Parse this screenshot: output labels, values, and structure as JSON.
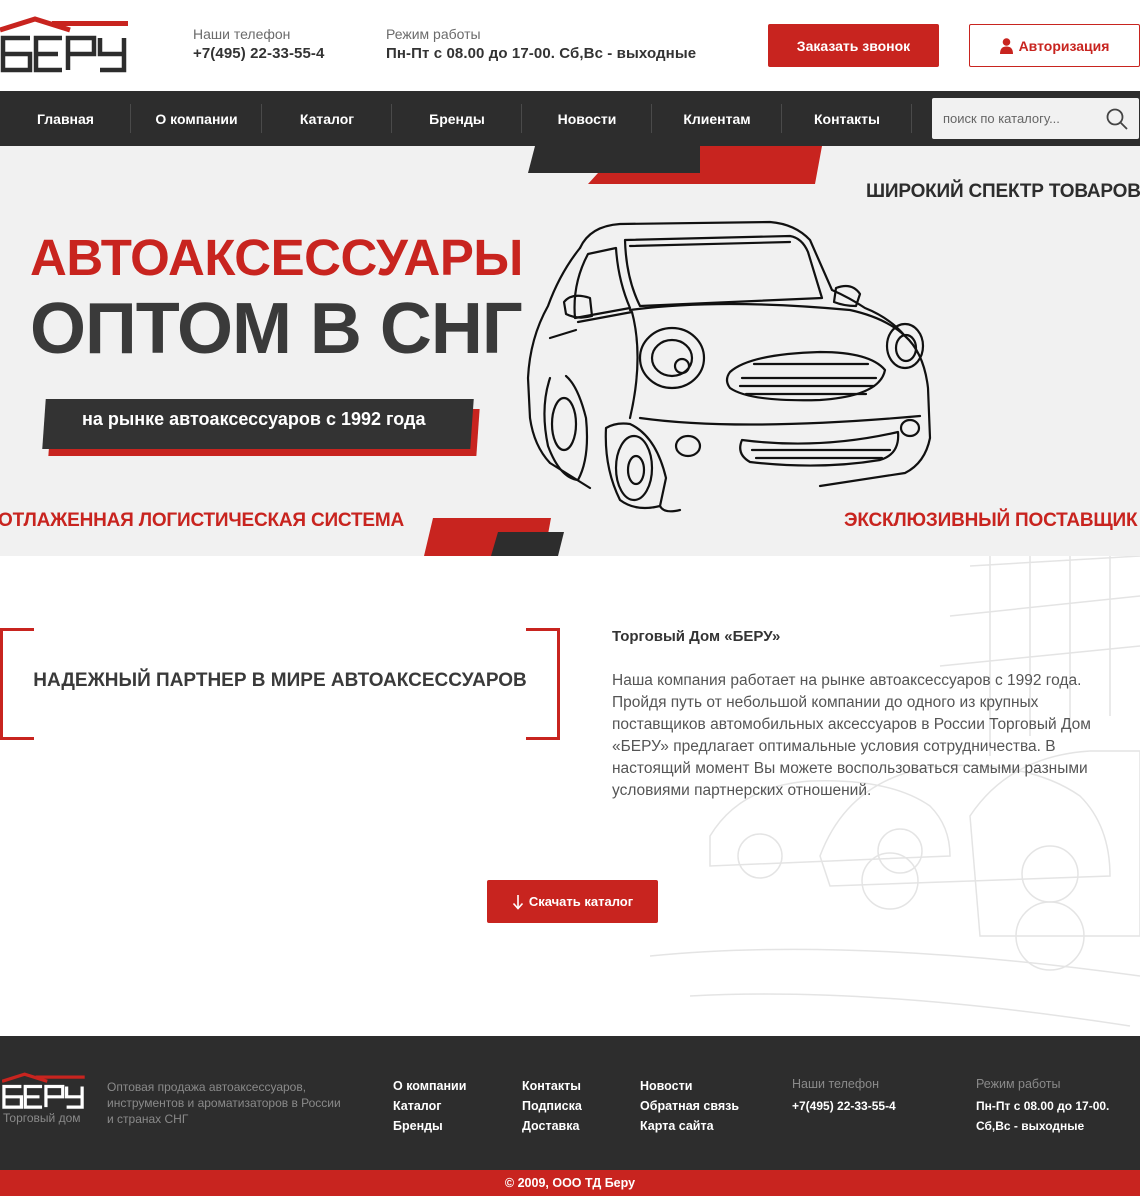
{
  "brand": {
    "logo_text": "БЕРУ",
    "sub": "Торговый дом"
  },
  "header": {
    "phone_label": "Наши телефон",
    "phone": "+7(495) 22-33-55-4",
    "hours_label": "Режим работы",
    "hours": "Пн-Пт с 08.00 до 17-00. Сб,Вс - выходные",
    "call_button": "Заказать звонок",
    "auth_button": "Авторизация"
  },
  "nav": {
    "items": [
      {
        "label": "Главная"
      },
      {
        "label": "О компании"
      },
      {
        "label": "Каталог"
      },
      {
        "label": "Бренды"
      },
      {
        "label": "Новости"
      },
      {
        "label": "Клиентам"
      },
      {
        "label": "Контакты"
      }
    ],
    "search_placeholder": "поиск по каталогу..."
  },
  "hero": {
    "title1": "АВТОАКСЕССУАРЫ",
    "title2": "ОПТОМ В СНГ",
    "banner": "на рынке автоаксессуаров с 1992 года",
    "tag_wide": "ШИРОКИЙ СПЕКТР ТОВАРОВ",
    "tag_logistics": "ОТЛАЖЕННАЯ ЛОГИСТИЧЕСКАЯ СИСТЕМА",
    "tag_exclusive": "ЭКСКЛЮЗИВНЫЙ ПОСТАВЩИК"
  },
  "about": {
    "slogan": "НАДЕЖНЫЙ ПАРТНЕР В МИРЕ АВТОАКСЕССУАРОВ",
    "heading": "Торговый Дом «БЕРУ»",
    "text": "Наша компания работает на рынке автоаксессуаров с 1992 года. Пройдя путь от небольшой компании до одного из крупных поставщиков автомобильных аксессуаров  в России Торговый Дом «БЕРУ» предлагает оптимальные условия сотрудничества. В настоящий момент Вы можете воспользоваться самыми разными  условиями партнерских отношений.",
    "download_button": "Скачать каталог"
  },
  "footer": {
    "desc": "Оптовая продажа автоаксессуаров, инструментов и ароматизаторов в России и странах СНГ",
    "col1": [
      "О компании",
      "Каталог",
      "Бренды"
    ],
    "col2": [
      "Контакты",
      "Подписка",
      "Доставка"
    ],
    "col3": [
      "Новости",
      "Обратная связь",
      "Карта сайта"
    ],
    "phone_label": "Наши телефон",
    "phone": "+7(495) 22-33-55-4",
    "hours_label": "Режим работы",
    "hours": "Пн-Пт с 08.00 до 17-00. Сб,Вс - выходные",
    "copyright": "© 2009, ООО ТД Беру"
  },
  "colors": {
    "accent": "#c8241f",
    "dark": "#2d2d2d",
    "hero_bg": "#f1f1f1"
  },
  "icons": {
    "user": "user-icon",
    "search": "search-icon",
    "download": "arrow-down-icon"
  }
}
